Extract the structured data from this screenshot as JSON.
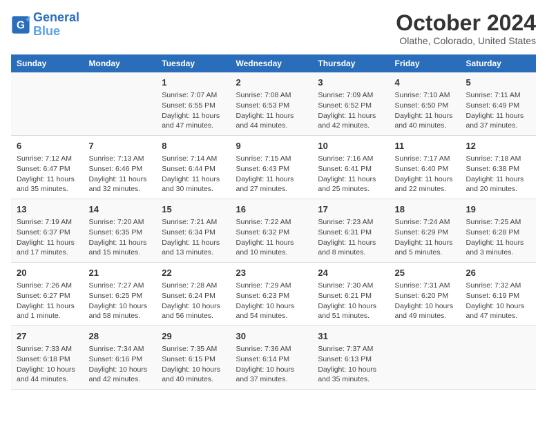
{
  "header": {
    "logo_line1": "General",
    "logo_line2": "Blue",
    "title": "October 2024",
    "subtitle": "Olathe, Colorado, United States"
  },
  "columns": [
    "Sunday",
    "Monday",
    "Tuesday",
    "Wednesday",
    "Thursday",
    "Friday",
    "Saturday"
  ],
  "weeks": [
    [
      {
        "day": "",
        "content": ""
      },
      {
        "day": "",
        "content": ""
      },
      {
        "day": "1",
        "content": "Sunrise: 7:07 AM\nSunset: 6:55 PM\nDaylight: 11 hours and 47 minutes."
      },
      {
        "day": "2",
        "content": "Sunrise: 7:08 AM\nSunset: 6:53 PM\nDaylight: 11 hours and 44 minutes."
      },
      {
        "day": "3",
        "content": "Sunrise: 7:09 AM\nSunset: 6:52 PM\nDaylight: 11 hours and 42 minutes."
      },
      {
        "day": "4",
        "content": "Sunrise: 7:10 AM\nSunset: 6:50 PM\nDaylight: 11 hours and 40 minutes."
      },
      {
        "day": "5",
        "content": "Sunrise: 7:11 AM\nSunset: 6:49 PM\nDaylight: 11 hours and 37 minutes."
      }
    ],
    [
      {
        "day": "6",
        "content": "Sunrise: 7:12 AM\nSunset: 6:47 PM\nDaylight: 11 hours and 35 minutes."
      },
      {
        "day": "7",
        "content": "Sunrise: 7:13 AM\nSunset: 6:46 PM\nDaylight: 11 hours and 32 minutes."
      },
      {
        "day": "8",
        "content": "Sunrise: 7:14 AM\nSunset: 6:44 PM\nDaylight: 11 hours and 30 minutes."
      },
      {
        "day": "9",
        "content": "Sunrise: 7:15 AM\nSunset: 6:43 PM\nDaylight: 11 hours and 27 minutes."
      },
      {
        "day": "10",
        "content": "Sunrise: 7:16 AM\nSunset: 6:41 PM\nDaylight: 11 hours and 25 minutes."
      },
      {
        "day": "11",
        "content": "Sunrise: 7:17 AM\nSunset: 6:40 PM\nDaylight: 11 hours and 22 minutes."
      },
      {
        "day": "12",
        "content": "Sunrise: 7:18 AM\nSunset: 6:38 PM\nDaylight: 11 hours and 20 minutes."
      }
    ],
    [
      {
        "day": "13",
        "content": "Sunrise: 7:19 AM\nSunset: 6:37 PM\nDaylight: 11 hours and 17 minutes."
      },
      {
        "day": "14",
        "content": "Sunrise: 7:20 AM\nSunset: 6:35 PM\nDaylight: 11 hours and 15 minutes."
      },
      {
        "day": "15",
        "content": "Sunrise: 7:21 AM\nSunset: 6:34 PM\nDaylight: 11 hours and 13 minutes."
      },
      {
        "day": "16",
        "content": "Sunrise: 7:22 AM\nSunset: 6:32 PM\nDaylight: 11 hours and 10 minutes."
      },
      {
        "day": "17",
        "content": "Sunrise: 7:23 AM\nSunset: 6:31 PM\nDaylight: 11 hours and 8 minutes."
      },
      {
        "day": "18",
        "content": "Sunrise: 7:24 AM\nSunset: 6:29 PM\nDaylight: 11 hours and 5 minutes."
      },
      {
        "day": "19",
        "content": "Sunrise: 7:25 AM\nSunset: 6:28 PM\nDaylight: 11 hours and 3 minutes."
      }
    ],
    [
      {
        "day": "20",
        "content": "Sunrise: 7:26 AM\nSunset: 6:27 PM\nDaylight: 11 hours and 1 minute."
      },
      {
        "day": "21",
        "content": "Sunrise: 7:27 AM\nSunset: 6:25 PM\nDaylight: 10 hours and 58 minutes."
      },
      {
        "day": "22",
        "content": "Sunrise: 7:28 AM\nSunset: 6:24 PM\nDaylight: 10 hours and 56 minutes."
      },
      {
        "day": "23",
        "content": "Sunrise: 7:29 AM\nSunset: 6:23 PM\nDaylight: 10 hours and 54 minutes."
      },
      {
        "day": "24",
        "content": "Sunrise: 7:30 AM\nSunset: 6:21 PM\nDaylight: 10 hours and 51 minutes."
      },
      {
        "day": "25",
        "content": "Sunrise: 7:31 AM\nSunset: 6:20 PM\nDaylight: 10 hours and 49 minutes."
      },
      {
        "day": "26",
        "content": "Sunrise: 7:32 AM\nSunset: 6:19 PM\nDaylight: 10 hours and 47 minutes."
      }
    ],
    [
      {
        "day": "27",
        "content": "Sunrise: 7:33 AM\nSunset: 6:18 PM\nDaylight: 10 hours and 44 minutes."
      },
      {
        "day": "28",
        "content": "Sunrise: 7:34 AM\nSunset: 6:16 PM\nDaylight: 10 hours and 42 minutes."
      },
      {
        "day": "29",
        "content": "Sunrise: 7:35 AM\nSunset: 6:15 PM\nDaylight: 10 hours and 40 minutes."
      },
      {
        "day": "30",
        "content": "Sunrise: 7:36 AM\nSunset: 6:14 PM\nDaylight: 10 hours and 37 minutes."
      },
      {
        "day": "31",
        "content": "Sunrise: 7:37 AM\nSunset: 6:13 PM\nDaylight: 10 hours and 35 minutes."
      },
      {
        "day": "",
        "content": ""
      },
      {
        "day": "",
        "content": ""
      }
    ]
  ]
}
